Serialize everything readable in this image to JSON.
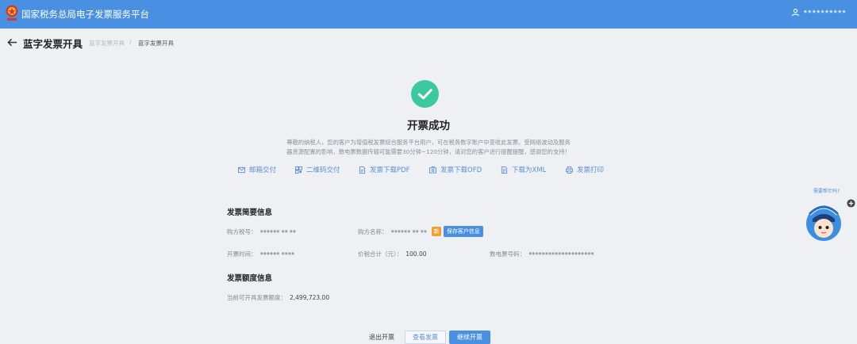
{
  "header": {
    "app_title": "国家税务总局电子发票服务平台",
    "user_name": "••••••••••"
  },
  "page": {
    "title": "蓝字发票开具",
    "breadcrumb_1": "蓝字发票开具",
    "breadcrumb_sep": "/",
    "breadcrumb_2": "蓝字发票开具"
  },
  "result": {
    "title": "开票成功",
    "notice_line1": "尊敬的纳税人，您的客户为增值税发票综合服务平台用户，可在税务数字账户中查收此发票。受网络波动及服务",
    "notice_line2": "器资源配置的影响，数电票数据传输可能需要30分钟~120分钟，请对您的客户进行提醒提醒，感谢您的支持！"
  },
  "actions": [
    {
      "label": "邮箱交付",
      "icon": "mail-icon"
    },
    {
      "label": "二维码交付",
      "icon": "qrcode-icon"
    },
    {
      "label": "发票下载PDF",
      "icon": "pdf-icon"
    },
    {
      "label": "发票下载OFD",
      "icon": "ofd-icon"
    },
    {
      "label": "下载为XML",
      "icon": "xml-icon"
    },
    {
      "label": "发票打印",
      "icon": "printer-icon"
    }
  ],
  "summary": {
    "title": "发票简要信息",
    "buyer_tax_no_label": "购方税号：",
    "buyer_tax_no": "•••••• •• ••",
    "buyer_name_label": "购方名称：",
    "buyer_name": "•••••• •• ••",
    "new_tag": "新",
    "save_customer_label": "保存客户信息",
    "issue_time_label": "开票时间：",
    "issue_time": "••••••  ••••",
    "total_label": "价税合计（元）：",
    "total": "100.00",
    "invoice_no_label": "数电票号码：",
    "invoice_no": "••••••••••••••••••••"
  },
  "quota": {
    "title": "发票额度信息",
    "available_label": "当前可开具发票额度：",
    "available": "2,499,723.00"
  },
  "buttons": {
    "exit": "退出开票",
    "view": "查看发票",
    "continue": "继续开票"
  },
  "assistant": {
    "label": "需要帮忙吗?"
  },
  "colors": {
    "primary": "#4a90e2",
    "success": "#3cc9a0",
    "page_bg": "#eef0f4"
  }
}
